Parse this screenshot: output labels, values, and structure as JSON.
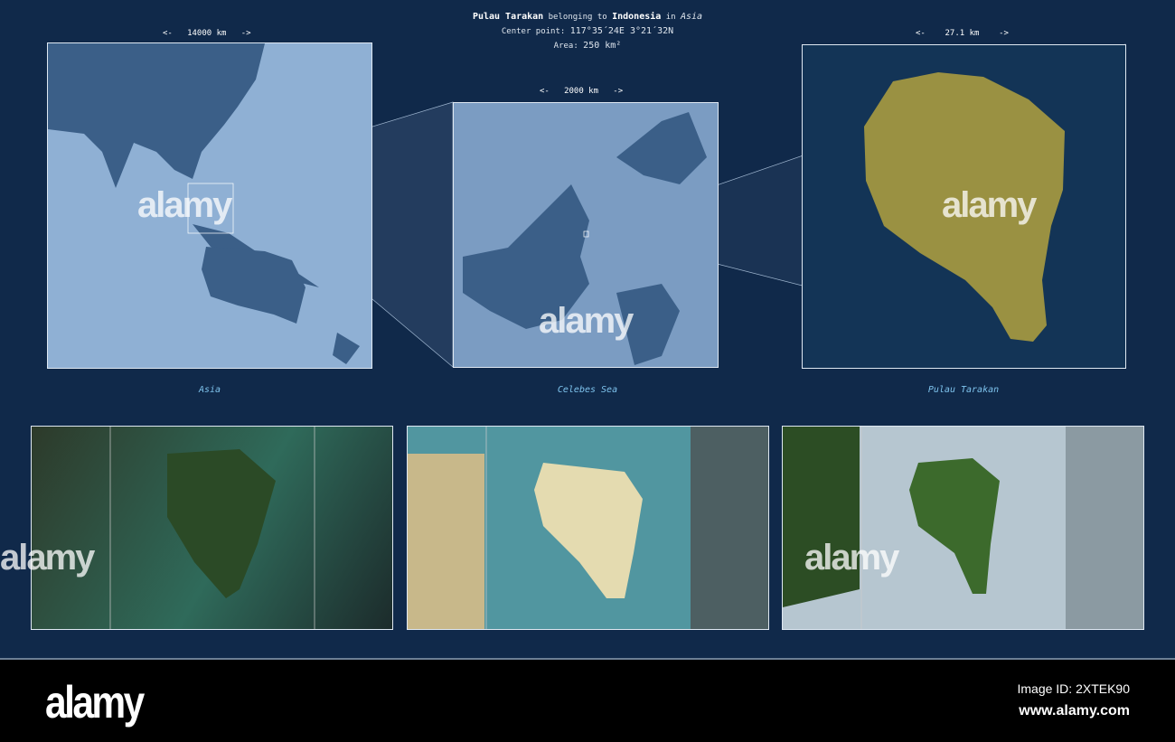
{
  "header": {
    "name": "Pulau Tarakan",
    "belonging": "belonging to",
    "country": "Indonesia",
    "in": "in",
    "continent": "Asia",
    "center_label": "Center point:",
    "center_value": "117°35´24E  3°21´32N",
    "area_label": "Area:",
    "area_value": "250 km²"
  },
  "panels": [
    {
      "scale": "<-   14000 km   ->",
      "caption": "Asia"
    },
    {
      "scale": "<-   2000 km   ->",
      "caption": "Celebes Sea"
    },
    {
      "scale": "<-    27.1 km    ->",
      "caption": "Pulau Tarakan"
    }
  ],
  "watermark": "alamy",
  "footer": {
    "logo": "alamy",
    "image_id": "Image ID: 2XTEK90",
    "url": "www.alamy.com"
  },
  "colors": {
    "background": "#10294a",
    "land": "#3b5f88",
    "island": "#9a9142",
    "sea_light": "#8fb0d4"
  }
}
